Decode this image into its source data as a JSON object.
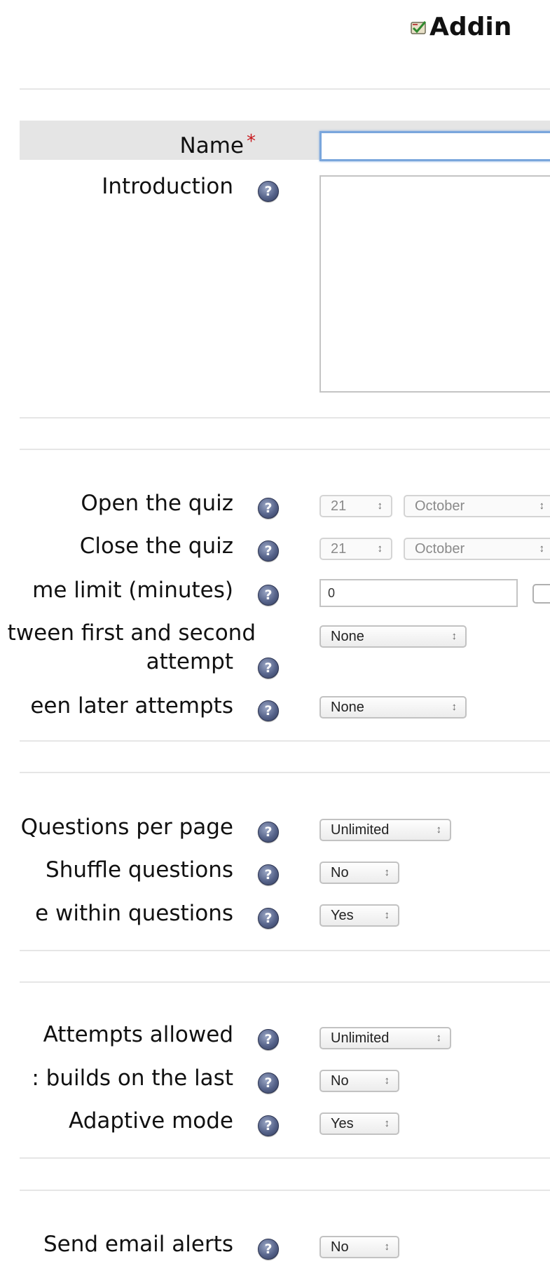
{
  "header": {
    "title": "Addin"
  },
  "general": {
    "name_label": "Name",
    "required_mark": "*",
    "name_value": "",
    "intro_label": "Introduction",
    "intro_value": ""
  },
  "timing": {
    "open_label": "Open the quiz",
    "open_day": "21",
    "open_month": "October",
    "close_label": "Close the quiz",
    "close_day": "21",
    "close_month": "October",
    "time_limit_label": "me limit (minutes)",
    "time_limit_value": "0",
    "delay_first_label_1": "tween first and second",
    "delay_first_label_2": "attempt",
    "delay_first_value": "None",
    "delay_later_label": "een later attempts",
    "delay_later_value": "None"
  },
  "display": {
    "qpp_label": "Questions per page",
    "qpp_value": "Unlimited",
    "shuffle_q_label": "Shuffle questions",
    "shuffle_q_value": "No",
    "shuffle_within_label": "e within questions",
    "shuffle_within_value": "Yes"
  },
  "attempts": {
    "allowed_label": "Attempts allowed",
    "allowed_value": "Unlimited",
    "builds_label": ": builds on the last",
    "builds_value": "No",
    "adaptive_label": "Adaptive mode",
    "adaptive_value": "Yes"
  },
  "notifications": {
    "email_label": "Send email alerts",
    "email_value": "No"
  },
  "icons": {
    "help": "?",
    "arrows": "↕"
  }
}
